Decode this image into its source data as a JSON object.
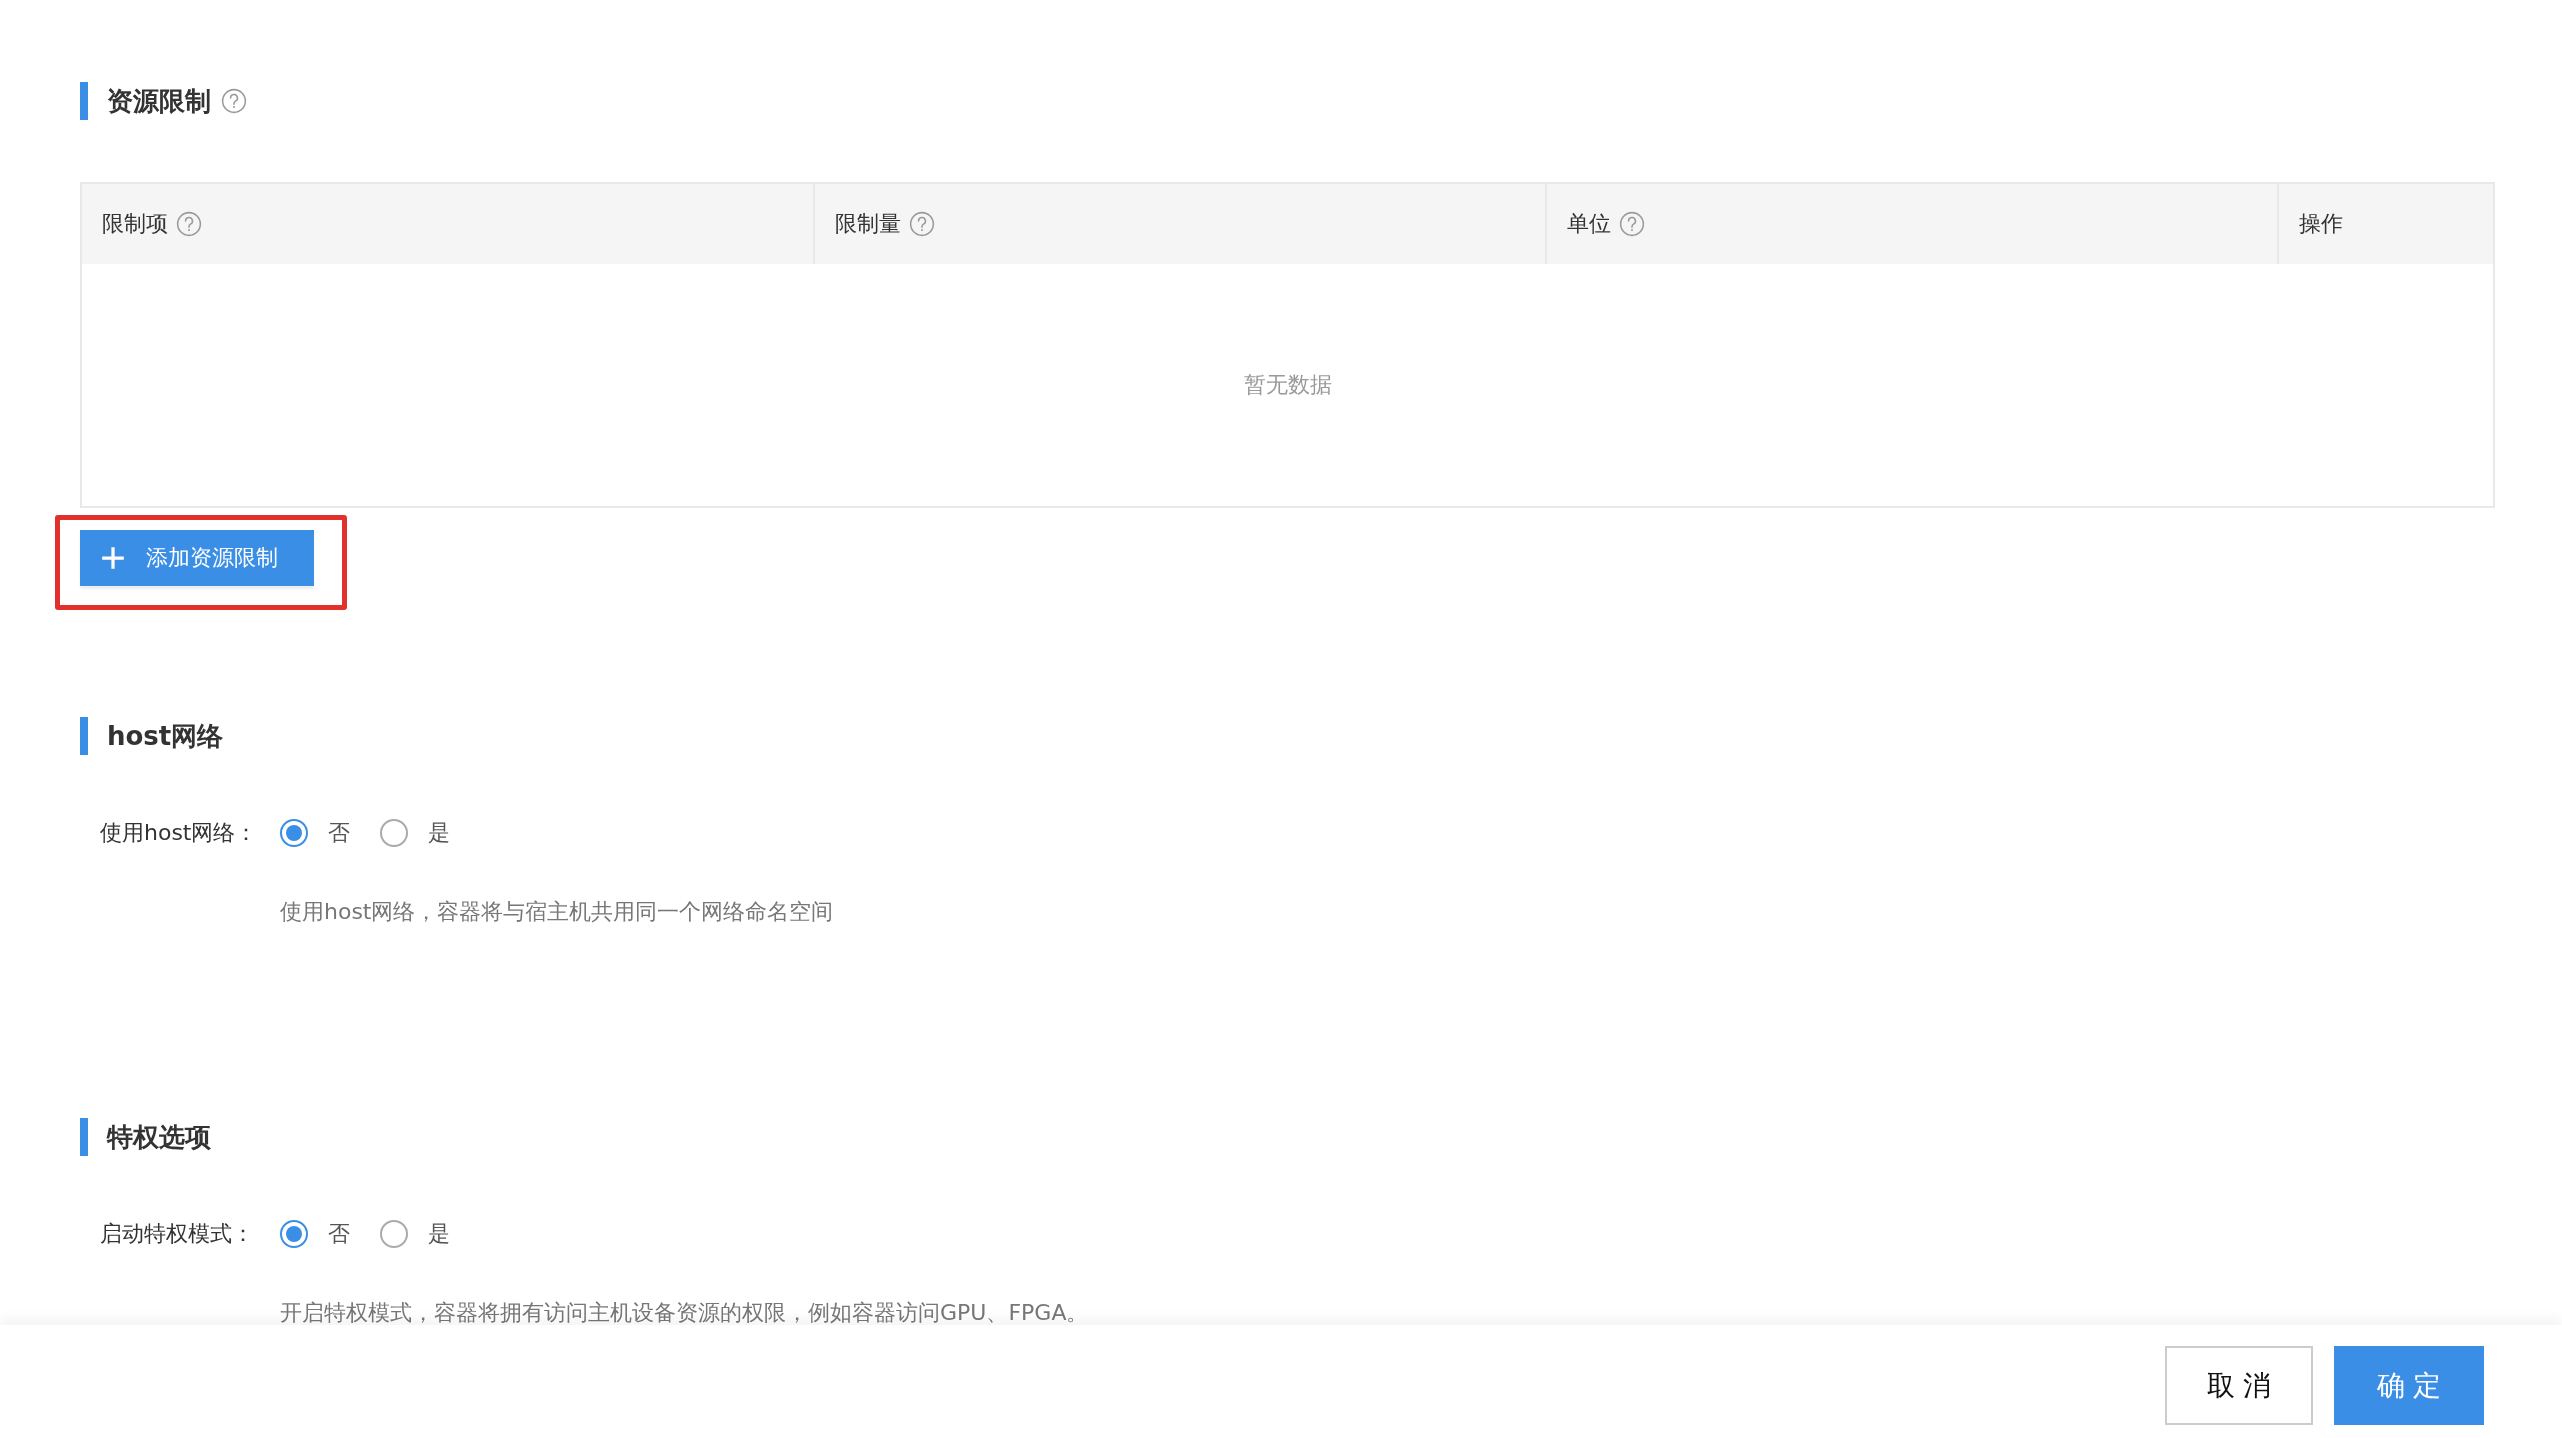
{
  "sections": [
    {
      "kind": "table",
      "title": "资源限制",
      "help": true,
      "table": {
        "columns": [
          {
            "label": "限制项",
            "help": true
          },
          {
            "label": "限制量",
            "help": true
          },
          {
            "label": "单位",
            "help": true
          },
          {
            "label": "操作",
            "help": false
          }
        ],
        "empty_text": "暂无数据"
      },
      "add_button": {
        "label": "添加资源限制",
        "highlighted": true
      }
    },
    {
      "kind": "radio",
      "title": "host网络",
      "help": false,
      "field": {
        "label": "使用host网络：",
        "options": [
          {
            "label": "否",
            "selected": true
          },
          {
            "label": "是",
            "selected": false
          }
        ],
        "hint": "使用host网络，容器将与宿主机共用同一个网络命名空间"
      }
    },
    {
      "kind": "radio",
      "title": "特权选项",
      "help": false,
      "field": {
        "label": "启动特权模式：",
        "options": [
          {
            "label": "否",
            "selected": true
          },
          {
            "label": "是",
            "selected": false
          }
        ],
        "hint": "开启特权模式，容器将拥有访问主机设备资源的权限，例如容器访问GPU、FPGA。"
      }
    }
  ],
  "footer": {
    "buttons": [
      {
        "label": "取 消",
        "kind": "default"
      },
      {
        "label": "确 定",
        "kind": "primary"
      }
    ]
  }
}
